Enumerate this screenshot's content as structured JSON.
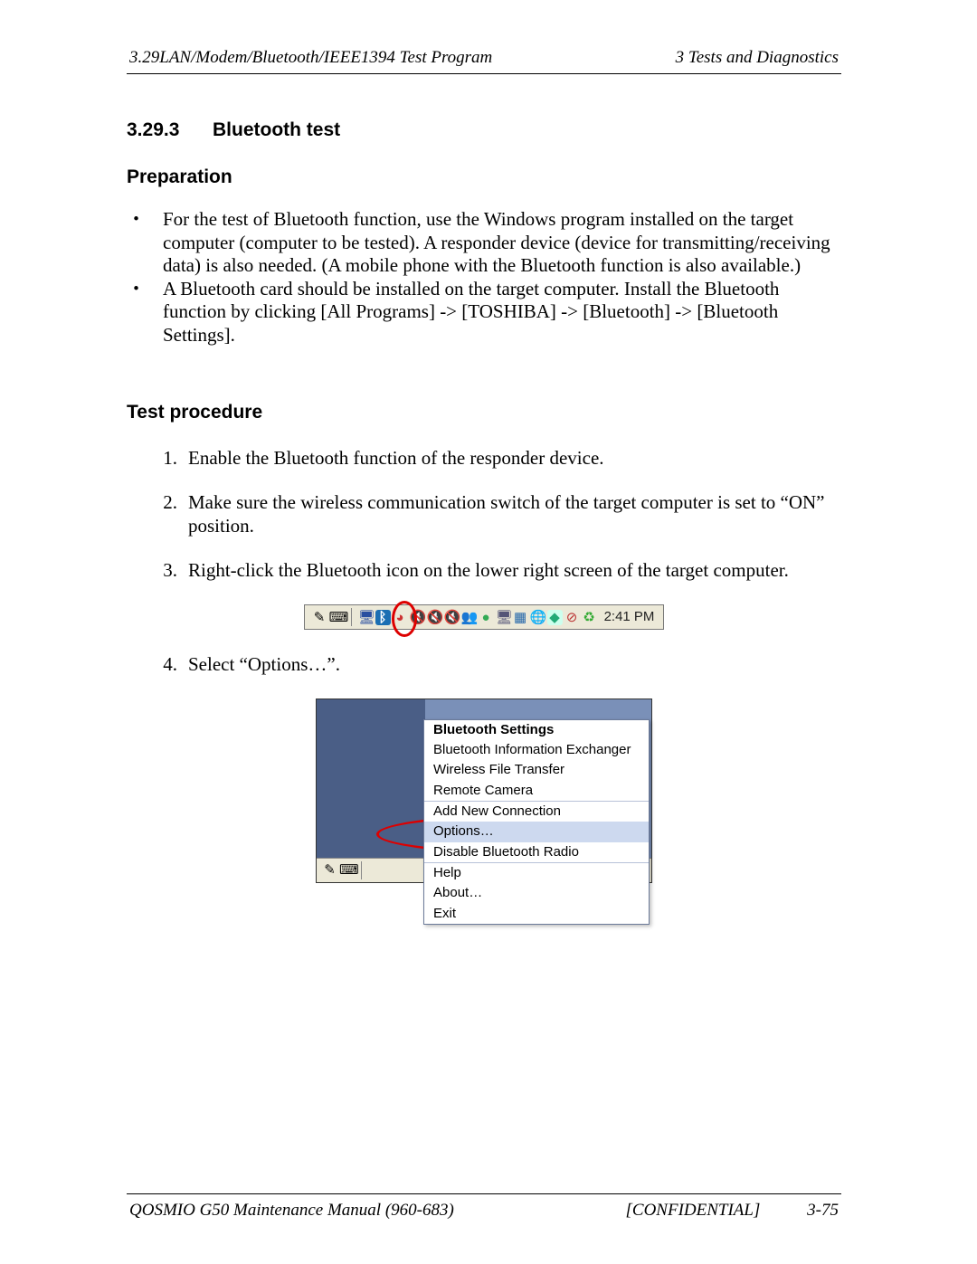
{
  "header": {
    "left": "3.29LAN/Modem/Bluetooth/IEEE1394 Test Program",
    "right": "3  Tests and Diagnostics"
  },
  "section": {
    "number": "3.29.3",
    "title": "Bluetooth test"
  },
  "prep": {
    "heading": "Preparation",
    "items": [
      "For the test of Bluetooth function, use the Windows program installed on the target computer (computer to be tested). A responder device (device for transmitting/receiving data) is also needed. (A mobile phone with the Bluetooth function is also available.)",
      "A Bluetooth card should be installed on the target computer.  Install the Bluetooth function by clicking [All Programs] -> [TOSHIBA] -> [Bluetooth] -> [Bluetooth Settings]."
    ]
  },
  "proc": {
    "heading": "Test procedure",
    "steps": [
      "Enable the Bluetooth function of the responder device.",
      "Make sure the wireless communication switch of the target computer is set to “ON” position.",
      "Right-click the Bluetooth icon on the lower right screen of the target computer.",
      "Select “Options…”."
    ]
  },
  "tray": {
    "clock": "2:41 PM",
    "icons": [
      "pen-icon",
      "keyboard-icon",
      "divider",
      "monitor-icon",
      "bluetooth-icon",
      "clock-red-icon",
      "speaker-x-icon",
      "speaker-x2-icon",
      "speaker-x3-icon",
      "people-icon",
      "ball-icon",
      "monitor2-icon",
      "grid-icon",
      "globe-icon",
      "shield-icon",
      "block-icon",
      "recycle-icon"
    ]
  },
  "menu": {
    "groups": [
      {
        "items": [
          "Bluetooth Settings",
          "Bluetooth Information Exchanger",
          "Wireless File Transfer",
          "Remote Camera"
        ],
        "title_index": 0
      },
      {
        "items": [
          "Add New Connection",
          "Options…",
          "Disable Bluetooth Radio"
        ],
        "hover_index": 1
      },
      {
        "items": [
          "Help",
          "About…",
          "Exit"
        ]
      }
    ]
  },
  "footer": {
    "left": "QOSMIO G50 Maintenance Manual (960-683)",
    "center": "[CONFIDENTIAL]",
    "right": "3-75"
  }
}
